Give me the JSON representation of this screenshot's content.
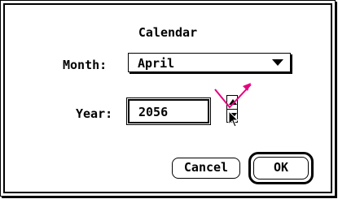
{
  "dialog": {
    "title": "Calendar",
    "month": {
      "label": "Month:",
      "value": "April"
    },
    "year": {
      "label": "Year:",
      "value": "2056"
    },
    "buttons": {
      "cancel": "Cancel",
      "ok": "OK"
    }
  },
  "icons": {
    "popup_arrow": "triangle-down-icon",
    "stepper_up": "arrow-up-icon",
    "stepper_down": "arrow-down-icon",
    "cursor": "mouse-pointer-icon"
  },
  "colors": {
    "annotation": "#e6007e",
    "ink": "#000000",
    "background": "#ffffff"
  }
}
